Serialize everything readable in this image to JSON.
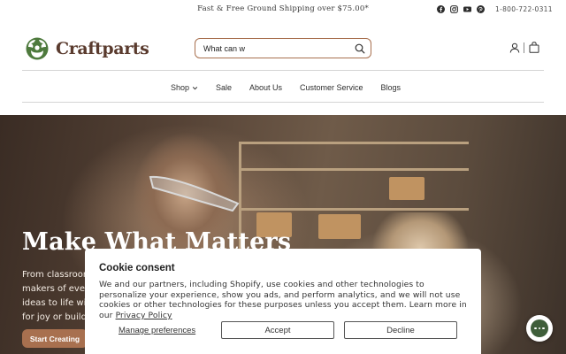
{
  "announcement": {
    "text": "Fast & Free Ground Shipping over $75.00*"
  },
  "social_icons": [
    "facebook-icon",
    "instagram-icon",
    "youtube-icon",
    "pinterest-icon"
  ],
  "contact": {
    "phone": "1-800-722-0311"
  },
  "brand": {
    "name": "Craftparts",
    "logo_color": "#4e7a3d",
    "text_color": "#5a3b2e"
  },
  "search": {
    "value": "What can w",
    "placeholder": ""
  },
  "nav": {
    "items": [
      {
        "label": "Shop",
        "has_dropdown": true
      },
      {
        "label": "Sale"
      },
      {
        "label": "About Us"
      },
      {
        "label": "Customer Service"
      },
      {
        "label": "Blogs"
      }
    ]
  },
  "hero": {
    "title": "Make What Matters",
    "lines": [
      "From classroom",
      "makers of every",
      "ideas to life with",
      "for joy or buildin"
    ],
    "cta": "Start Creating"
  },
  "cookie": {
    "title": "Cookie consent",
    "body": "We and our partners, including Shopify, use cookies and other technologies to personalize your experience, show you ads, and perform analytics, and we will not use cookies or other technologies for these purposes unless you accept them. Learn more in our",
    "link": "Privacy Policy",
    "manage": "Manage preferences",
    "accept": "Accept",
    "decline": "Decline"
  },
  "colors": {
    "accent": "#a8704f",
    "chat_bubble": "#3f5e3a"
  }
}
